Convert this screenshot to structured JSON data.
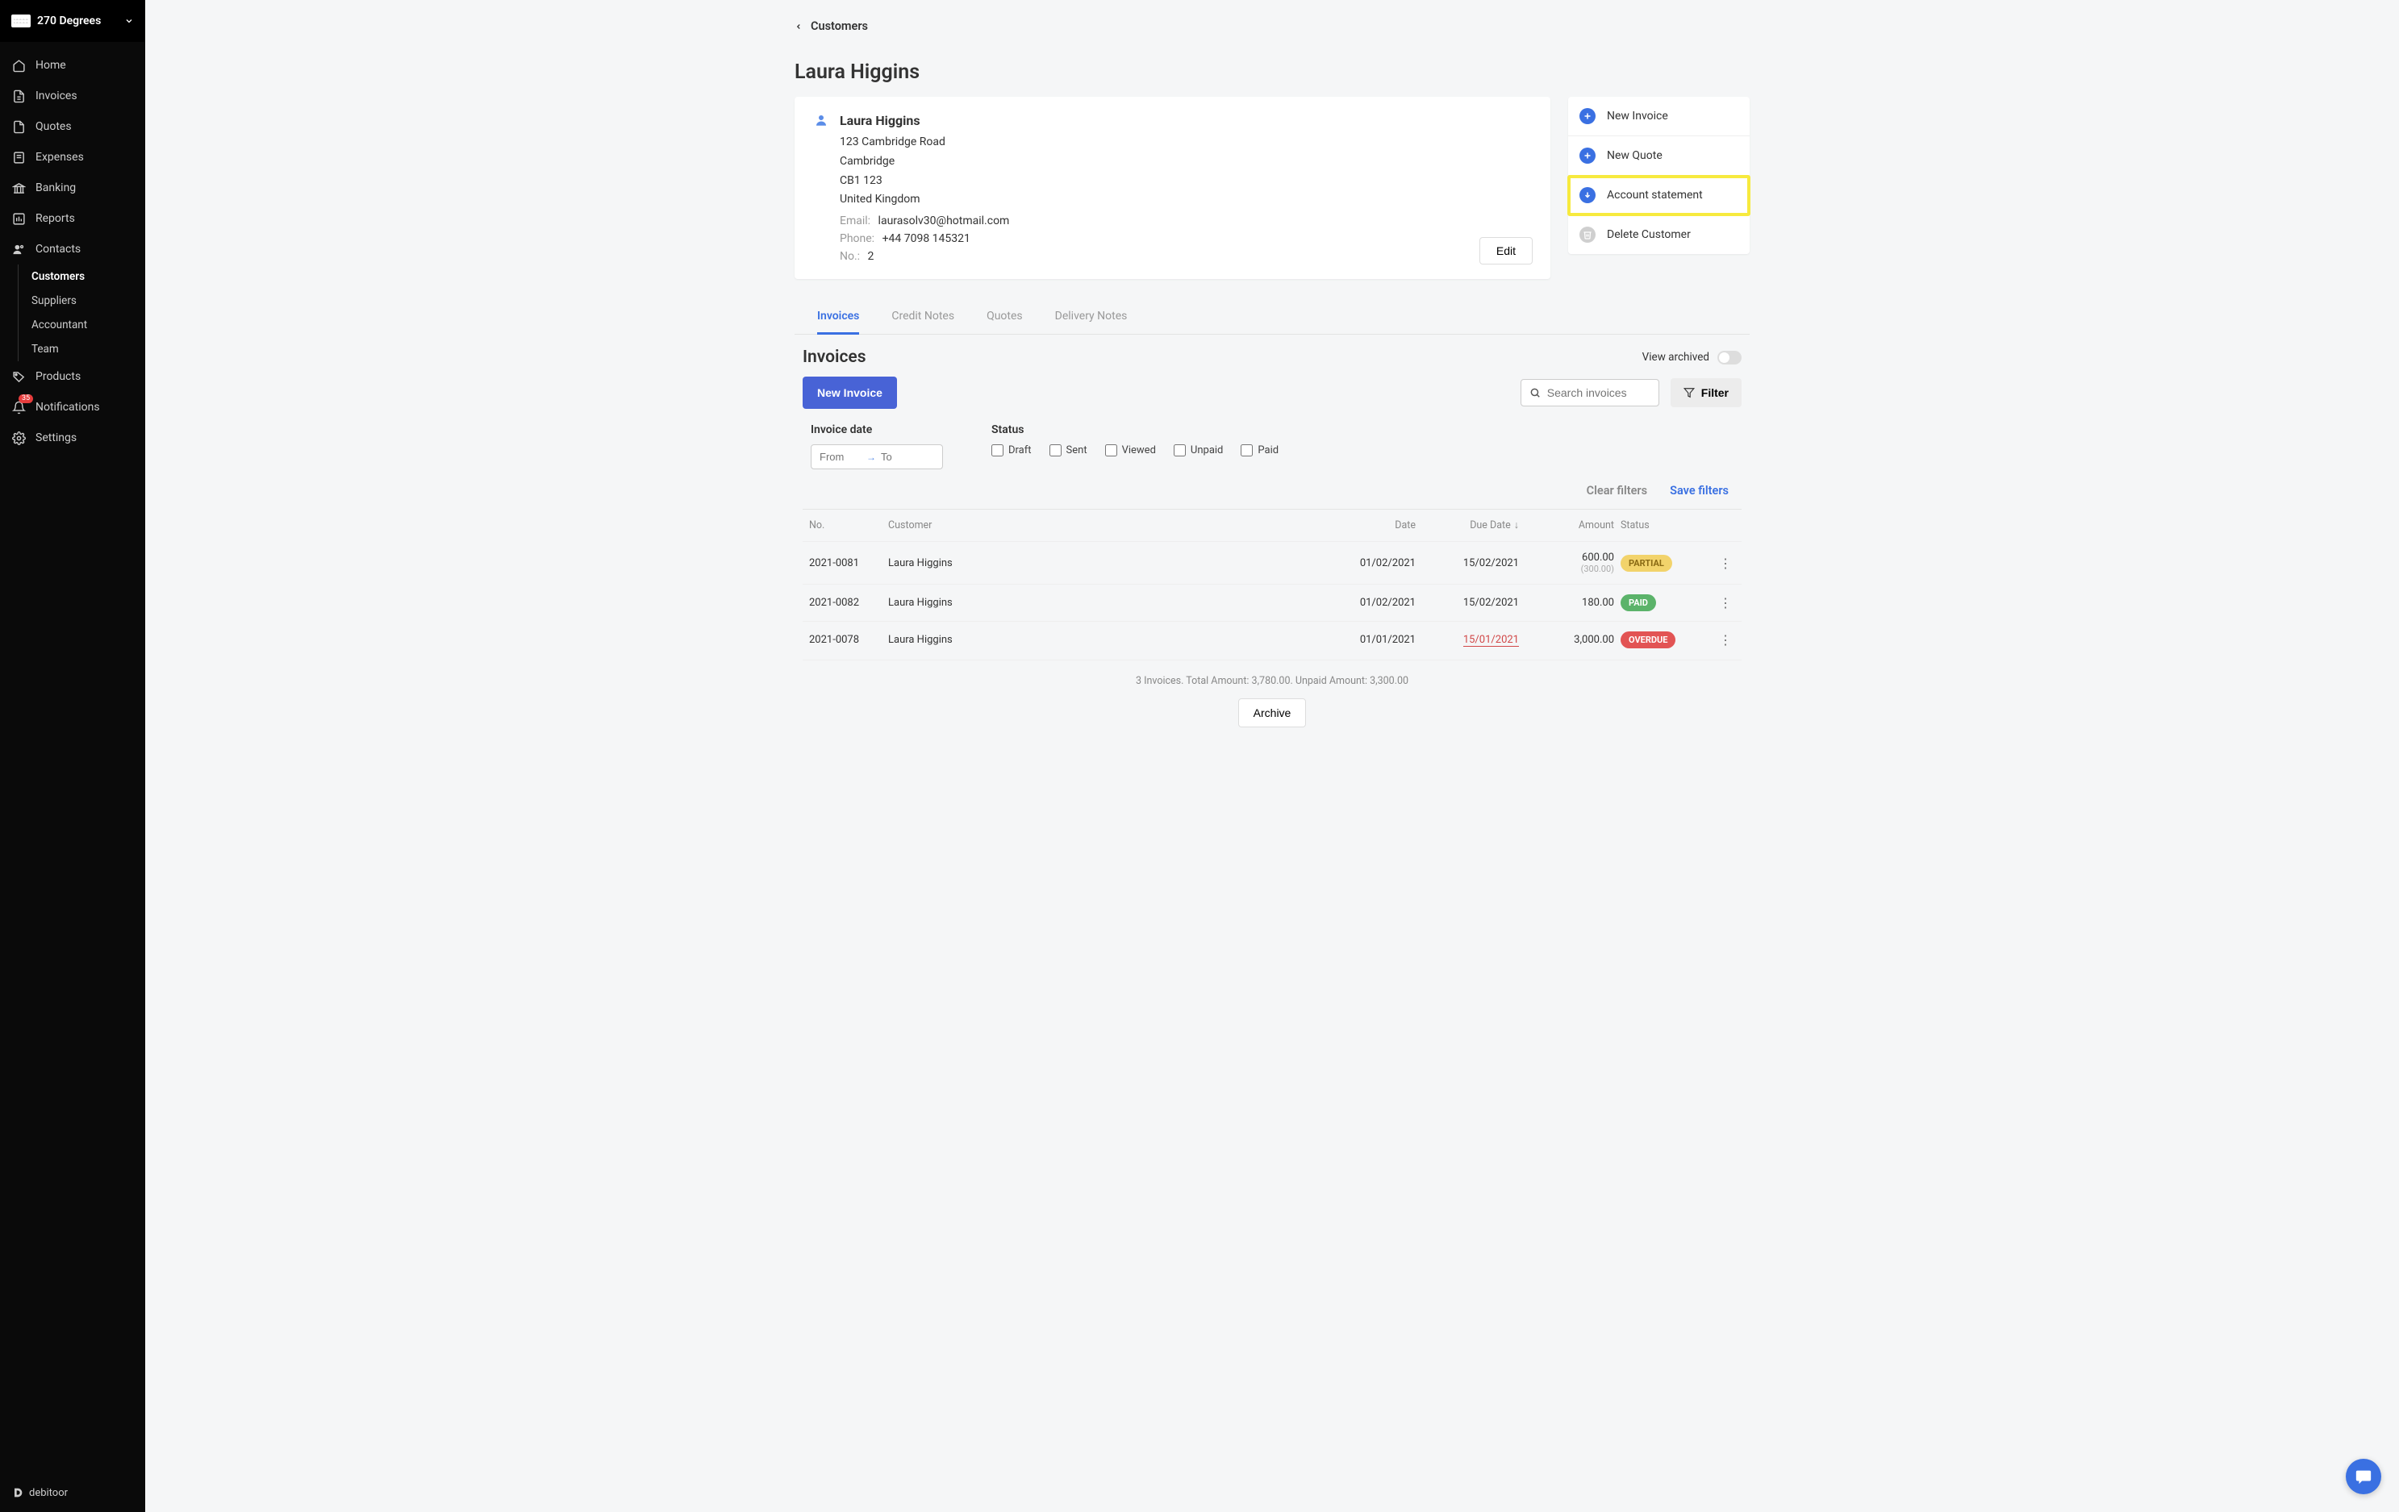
{
  "workspace": {
    "name": "270 Degrees"
  },
  "sidebar": {
    "items": [
      {
        "label": "Home"
      },
      {
        "label": "Invoices"
      },
      {
        "label": "Quotes"
      },
      {
        "label": "Expenses"
      },
      {
        "label": "Banking"
      },
      {
        "label": "Reports"
      },
      {
        "label": "Contacts"
      },
      {
        "label": "Products"
      },
      {
        "label": "Notifications",
        "badge": "35"
      },
      {
        "label": "Settings"
      }
    ],
    "contacts_sub": [
      {
        "label": "Customers",
        "active": true
      },
      {
        "label": "Suppliers"
      },
      {
        "label": "Accountant"
      },
      {
        "label": "Team"
      }
    ],
    "footer": "debitoor"
  },
  "breadcrumb": {
    "label": "Customers"
  },
  "page_title": "Laura Higgins",
  "customer": {
    "name": "Laura Higgins",
    "street": "123 Cambridge Road",
    "city": "Cambridge",
    "postcode": "CB1 123",
    "country": "United Kingdom",
    "email_label": "Email:",
    "email": "laurasolv30@hotmail.com",
    "phone_label": "Phone:",
    "phone": "+44 7098 145321",
    "no_label": "No.:",
    "no": "2",
    "edit_label": "Edit"
  },
  "actions": [
    {
      "label": "New Invoice",
      "icon": "plus",
      "style": "blue"
    },
    {
      "label": "New Quote",
      "icon": "plus",
      "style": "blue"
    },
    {
      "label": "Account statement",
      "icon": "download",
      "style": "blue",
      "highlight": true
    },
    {
      "label": "Delete Customer",
      "icon": "trash",
      "style": "grey"
    }
  ],
  "tabs": [
    {
      "label": "Invoices",
      "active": true
    },
    {
      "label": "Credit Notes"
    },
    {
      "label": "Quotes"
    },
    {
      "label": "Delivery Notes"
    }
  ],
  "section": {
    "title": "Invoices",
    "view_archived_label": "View archived",
    "new_invoice_label": "New Invoice",
    "search_placeholder": "Search invoices",
    "filter_label": "Filter"
  },
  "filters": {
    "date_title": "Invoice date",
    "from_placeholder": "From",
    "to_placeholder": "To",
    "status_title": "Status",
    "statuses": [
      "Draft",
      "Sent",
      "Viewed",
      "Unpaid",
      "Paid"
    ],
    "clear_label": "Clear filters",
    "save_label": "Save filters"
  },
  "table": {
    "headers": {
      "no": "No.",
      "customer": "Customer",
      "date": "Date",
      "due": "Due Date",
      "amount": "Amount",
      "status": "Status"
    },
    "rows": [
      {
        "no": "2021-0081",
        "customer": "Laura Higgins",
        "date": "01/02/2021",
        "due": "15/02/2021",
        "amount": "600.00",
        "amount_sub": "(300.00)",
        "status": "PARTIAL",
        "status_type": "partial"
      },
      {
        "no": "2021-0082",
        "customer": "Laura Higgins",
        "date": "01/02/2021",
        "due": "15/02/2021",
        "amount": "180.00",
        "status": "PAID",
        "status_type": "paid"
      },
      {
        "no": "2021-0078",
        "customer": "Laura Higgins",
        "date": "01/01/2021",
        "due": "15/01/2021",
        "due_overdue": true,
        "amount": "3,000.00",
        "status": "OVERDUE",
        "status_type": "overdue"
      }
    ],
    "summary": "3 Invoices. Total Amount: 3,780.00. Unpaid Amount: 3,300.00",
    "archive_label": "Archive"
  }
}
